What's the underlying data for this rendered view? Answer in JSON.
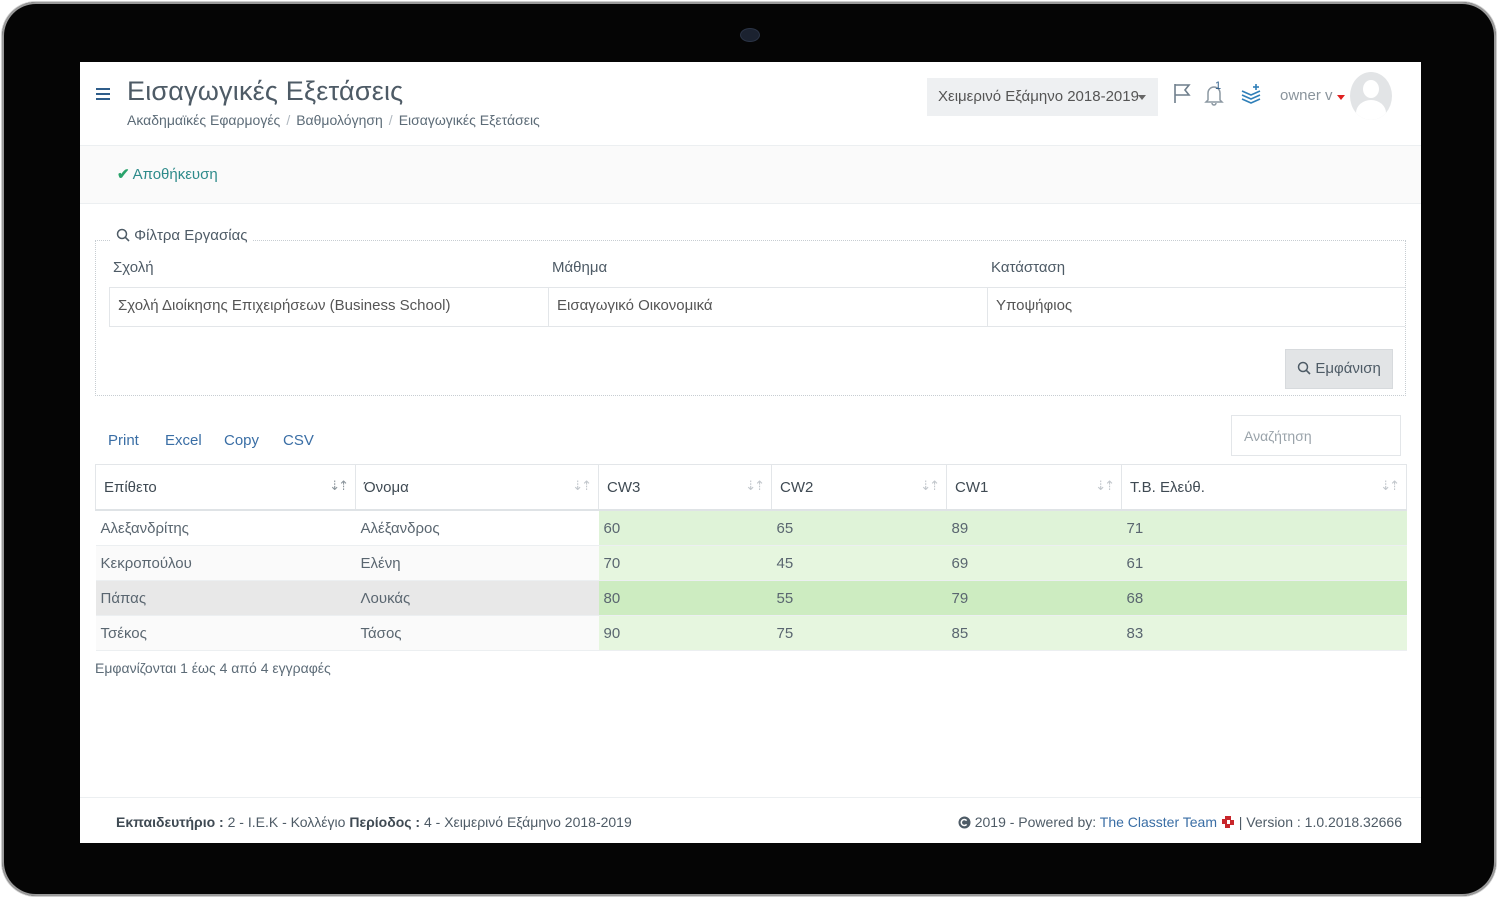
{
  "header": {
    "title": "Εισαγωγικές Εξετάσεις",
    "breadcrumb": [
      "Ακαδημαϊκές Εφαρμογές",
      "Βαθμολόγηση",
      "Εισαγωγικές Εξετάσεις"
    ],
    "semester": "Χειμερινό Εξάμηνο 2018-2019",
    "notification_count": "1",
    "user": "owner v"
  },
  "toolbar": {
    "save_label": "Αποθήκευση"
  },
  "filters": {
    "legend": "Φίλτρα Εργασίας",
    "school_label": "Σχολή",
    "school_value": "Σχολή Διοίκησης Επιχειρήσεων (Business School)",
    "course_label": "Μάθημα",
    "course_value": "Εισαγωγικό Οικονομικά",
    "status_label": "Κατάσταση",
    "status_value": "Υποψήφιος",
    "show_label": "Εμφάνιση"
  },
  "export": [
    "Print",
    "Excel",
    "Copy",
    "CSV"
  ],
  "search": {
    "placeholder": "Αναζήτηση"
  },
  "table": {
    "columns": [
      "Επίθετο",
      "Όνομα",
      "CW3",
      "CW2",
      "CW1",
      "Τ.Β. Ελεύθ."
    ],
    "rows": [
      [
        "Αλεξανδρίτης",
        "Αλέξανδρος",
        "60",
        "65",
        "89",
        "71"
      ],
      [
        "Κεκροπούλου",
        "Ελένη",
        "70",
        "45",
        "69",
        "61"
      ],
      [
        "Πάπας",
        "Λουκάς",
        "80",
        "55",
        "79",
        "68"
      ],
      [
        "Τσέκος",
        "Τάσος",
        "90",
        "75",
        "85",
        "83"
      ]
    ],
    "info": "Εμφανίζονται 1 έως 4 από 4 εγγραφές"
  },
  "footer": {
    "training_label": "Εκπαιδευτήριο :",
    "training_value": " 2 - Ι.Ε.Κ - Κολλέγιο ",
    "period_label": "Περίοδος :",
    "period_value": " 4 - Χειμερινό Εξάμηνο 2018-2019",
    "powered_prefix": "2019 - Powered by: ",
    "team": "The Classter Team",
    "version": "| Version : 1.0.2018.32666"
  },
  "colors": {
    "accent": "#3a6ea5",
    "save": "#2e8b8b",
    "grade_cell": "#dff3d8",
    "grade_cell_hl": "#cdecc1"
  }
}
